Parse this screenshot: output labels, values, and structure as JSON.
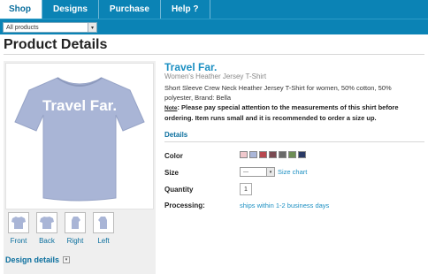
{
  "tabs": [
    {
      "label": "Shop"
    },
    {
      "label": "Designs"
    },
    {
      "label": "Purchase"
    },
    {
      "label": "Help ?"
    }
  ],
  "category_select": {
    "value": "All products",
    "arrow": "▾"
  },
  "page_title": "Product Details",
  "product": {
    "image_text": "Travel Far.",
    "shirt_color": "#a9b5d6",
    "name": "Travel Far.",
    "subtitle": "Women's Heather Jersey T-Shirt",
    "description": "Short Sleeve Crew Neck Heather Jersey T-Shirt for women, 50% cotton, 50% polyester, Brand: Bella",
    "note_label": "Note",
    "note_text": ": Please pay special attention to the measurements of this shirt before ordering. Item runs small and it is recommended to order a size up."
  },
  "views": [
    {
      "label": "Front"
    },
    {
      "label": "Back"
    },
    {
      "label": "Right"
    },
    {
      "label": "Left"
    }
  ],
  "design_details": {
    "label": "Design details",
    "arrow": "▾"
  },
  "details_heading": "Details",
  "options": {
    "color_label": "Color",
    "colors": [
      "#f0c8cc",
      "#aab6d8",
      "#b8484f",
      "#7a4a52",
      "#6a6a6a",
      "#6d8e54",
      "#2a3a66"
    ],
    "size_label": "Size",
    "size_value": "---",
    "size_arrow": "▾",
    "size_chart": "Size chart",
    "quantity_label": "Quantity",
    "quantity_value": "1",
    "processing_label": "Processing:",
    "processing_value": "ships within 1-2 business days"
  }
}
